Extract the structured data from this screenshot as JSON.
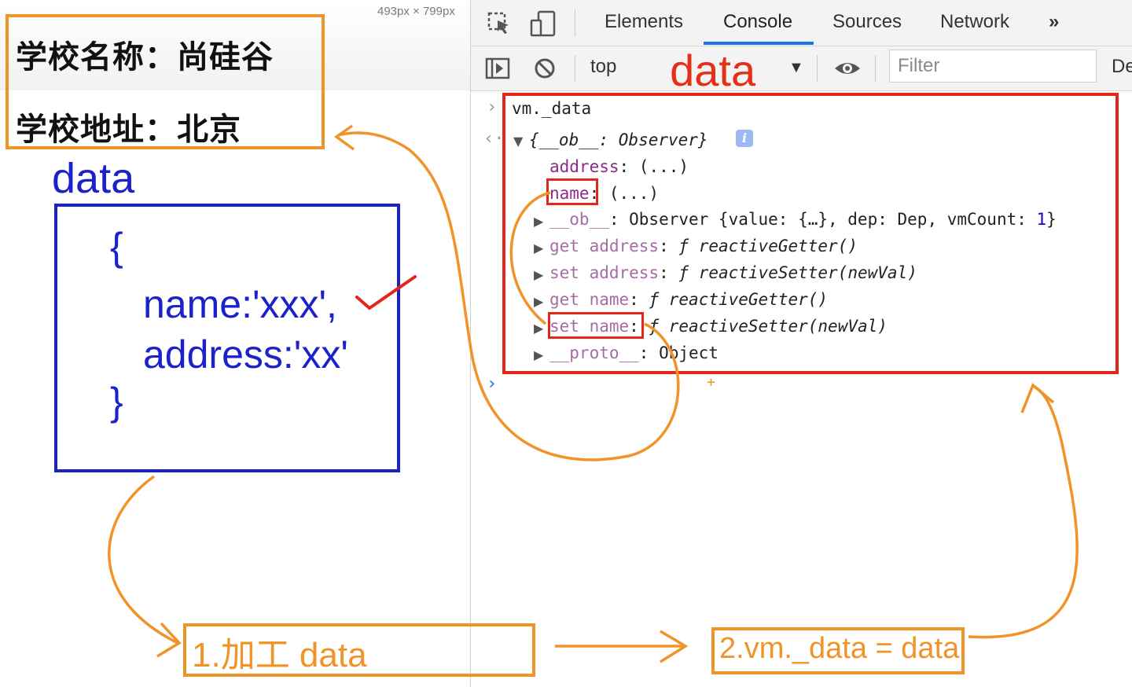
{
  "left_pane": {
    "viewport_size": "493px × 799px",
    "school": {
      "name_line": "学校名称：尚硅谷",
      "address_line": "学校地址：北京"
    },
    "data_title": "data",
    "code": {
      "open_brace": "{",
      "name_line": "name:'xxx',",
      "address_line": "address:'xx'",
      "close_brace": "}"
    }
  },
  "devtools": {
    "tabs": [
      "Elements",
      "Console",
      "Sources",
      "Network"
    ],
    "more_tabs": "»",
    "active_tab": "Console",
    "toolbar": {
      "context": "top",
      "annotation": "_data",
      "filter_placeholder": "Filter",
      "cut_label": "De"
    },
    "console": {
      "input": "vm._data",
      "result_head": "{__ob__: Observer}",
      "lines": {
        "address_key": "address",
        "address_val": ": (...)",
        "name_key": "name",
        "name_val": ": (...)",
        "ob_key": "__ob__",
        "ob_val_pre": ": Observer {value: {…}, dep: Dep, vmCount: ",
        "ob_count": "1",
        "ob_val_post": "}",
        "get_address_key": "get address",
        "get_address_val": "reactiveGetter()",
        "set_address_key": "set address",
        "set_address_val": "reactiveSetter(newVal)",
        "get_name_key": "get name",
        "get_name_val": "reactiveGetter()",
        "set_name_key": "set name",
        "set_name_val": "reactiveSetter(newVal)",
        "proto_key": "__proto__",
        "proto_val": ": Object",
        "f_glyph": "ƒ"
      }
    }
  },
  "annotations": {
    "step1": "1.加工 data",
    "step2": "2.vm._data = data",
    "plus": "+"
  },
  "colors": {
    "orange": "#f0942a",
    "blue": "#1b22c9",
    "red": "#e3251b",
    "devtools_accent": "#1a73e8"
  }
}
